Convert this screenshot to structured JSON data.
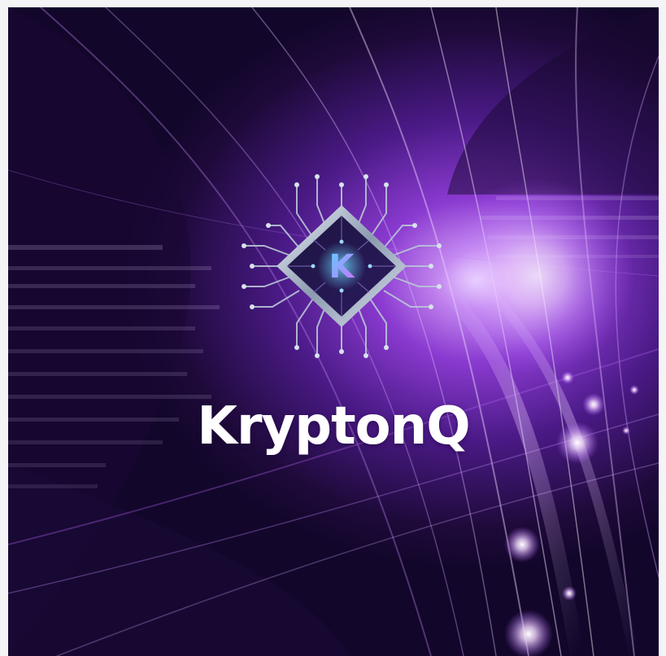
{
  "brand": {
    "name": "KryptonQ",
    "chip_letter": "K"
  },
  "colors": {
    "background_dark": "#12062a",
    "purple_mid": "#8a3ad0",
    "purple_light": "#c58af0",
    "glow": "#f3e6ff",
    "chip_metal": "#b8c6d6",
    "chip_letter_gradient_start": "#5fd0ff",
    "chip_letter_gradient_end": "#d06bff",
    "text": "#ffffff"
  },
  "icons": [
    "circuit-chip-logo-icon"
  ]
}
